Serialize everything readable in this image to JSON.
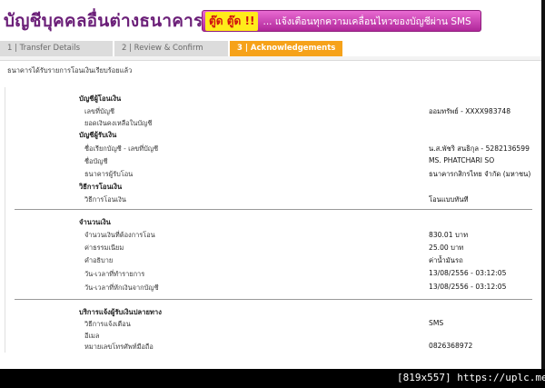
{
  "header": {
    "title": "บัญชีบุคคลอื่นต่างธนาคาร",
    "sms_tag": "ตู๊ด ตู๊ด !!",
    "sms_text": "... แจ้งเตือนทุกความเคลื่อนไหวของบัญชีผ่าน SMS"
  },
  "tabs": [
    {
      "label": "1 | Transfer Details",
      "state": "inactive"
    },
    {
      "label": "2 | Review & Confirm",
      "state": "inactive"
    },
    {
      "label": "3 | Acknowledgements",
      "state": "active"
    }
  ],
  "notice": "ธนาคารได้รับรายการโอนเงินเรียบร้อยแล้ว",
  "from_account": {
    "heading": "บัญชีผู้โอนเงิน",
    "account_number_label": "เลขที่บัญชี",
    "account_number_value": "ออมทรัพย์ - XXXX983748",
    "balance_label": "ยอดเงินคงเหลือในบัญชี"
  },
  "to_account": {
    "heading": "บัญชีผู้รับเงิน",
    "nickname_label": "ชื่อเรียกบัญชี - เลขที่บัญชี",
    "nickname_value": "น.ส.พัชริ สนธิกุล - 5282136599",
    "name_label": "ชื่อบัญชี",
    "name_value": "MS. PHATCHARI SO",
    "bank_label": "ธนาคารผู้รับโอน",
    "bank_value": "ธนาคารกสิกรไทย จำกัด (มหาชน)"
  },
  "method": {
    "heading": "วิธีการโอนเงิน",
    "method_label": "วิธีการโอนเงิน",
    "method_value": "โอนแบบทันที"
  },
  "amount": {
    "heading": "จำนวนเงิน",
    "amount_label": "จำนวนเงินที่ต้องการโอน",
    "amount_value": "830.01 บาท",
    "fee_label": "ค่าธรรมเนียม",
    "fee_value": "25.00 บาท",
    "memo_label": "คำอธิบาย",
    "memo_value": "ค่าน้ำมันรถ",
    "txn_date_label": "วัน-เวลาที่ทำรายการ",
    "txn_date_value": "13/08/2556 - 03:12:05",
    "debit_date_label": "วัน-เวลาที่หักเงินจากบัญชี",
    "debit_date_value": "13/08/2556 - 03:12:05"
  },
  "notify": {
    "heading": "บริการแจ้งผู้รับเงินปลายทาง",
    "method_label": "วิธีการแจ้งเตือน",
    "method_value": "SMS",
    "email_label": "อีเมล",
    "phone_label": "หมายเลขโทรศัพท์มือถือ",
    "phone_value": "0826368972"
  },
  "footer": {
    "resolution": "[819x557]",
    "site": "https://uplc.me/"
  }
}
